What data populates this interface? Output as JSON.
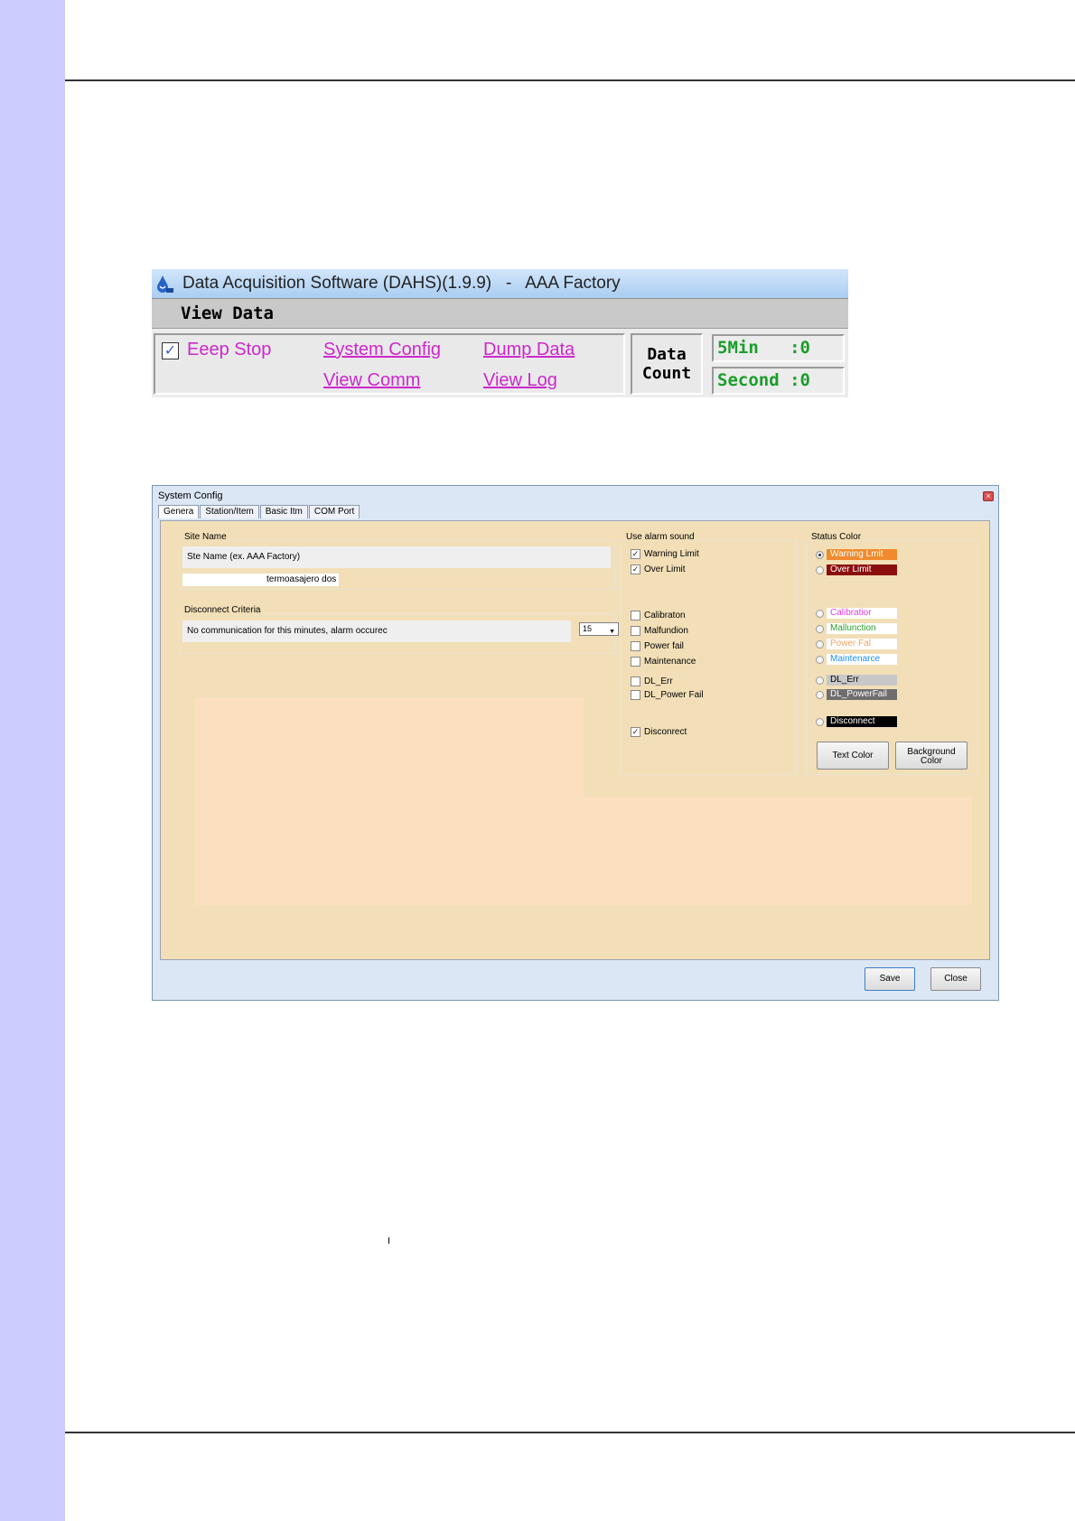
{
  "dahs_window": {
    "title": "Data Acquisition Software (DAHS)(1.9.9)   -   AAA Factory",
    "menu_view_data": "View Data",
    "beep_stop": {
      "label": "Eeep Stop",
      "checked": true
    },
    "links": {
      "system_config": "System Config",
      "dump_data": "Dump Data",
      "view_comm": "View Comm",
      "view_log": "View Log"
    },
    "data_count_label_line1": "Data",
    "data_count_label_line2": "Count",
    "count_5min": "5Min   :0",
    "count_second": "Second :0",
    "colors": {
      "link": "#cc28cc",
      "count": "#1a9e2a",
      "titlebar": "#b9d7f4"
    },
    "icon": "water-drop-logo-icon"
  },
  "system_config": {
    "title": "System Config",
    "tabs": [
      "Genera",
      "Station/Item",
      "Basic Itm",
      "COM Port"
    ],
    "active_tab": "Genera",
    "site_name": {
      "group_title": "Site Name",
      "hint": "Ste Name (ex. AAA Factory)",
      "value": "termoasajero dos"
    },
    "disconnect_criteria": {
      "group_title": "Disconnect Criteria",
      "description": "No communication for this minutes, alarm occurec",
      "minutes_value": "15"
    },
    "alarm_sound": {
      "group_title": "Use alarm sound",
      "items": [
        {
          "label": "Warning Limit",
          "checked": true
        },
        {
          "label": "Over Limit",
          "checked": true
        },
        {
          "label": "Calibraton",
          "checked": false
        },
        {
          "label": "Malfundion",
          "checked": false
        },
        {
          "label": "Power fail",
          "checked": false
        },
        {
          "label": "Maintenance",
          "checked": false
        },
        {
          "label": "DL_Err",
          "checked": false
        },
        {
          "label": "DL_Power Fail",
          "checked": false
        },
        {
          "label": "Disconrect",
          "checked": true
        }
      ]
    },
    "status_color": {
      "group_title": "Status Color",
      "items": [
        {
          "label": "Warning Lmit",
          "bg": "#f08a2c",
          "fg": "#ffffff",
          "selected": true
        },
        {
          "label": "Over Limit",
          "bg": "#8b0f0f",
          "fg": "#ffffff",
          "selected": false
        },
        {
          "label": "Calibratior",
          "bg": "#ffffff",
          "fg": "#e23ce2",
          "selected": false
        },
        {
          "label": "Mallunction",
          "bg": "#ffffff",
          "fg": "#2ca02c",
          "selected": false
        },
        {
          "label": "Power Fal",
          "bg": "#ffffff",
          "fg": "#f4a460",
          "selected": false
        },
        {
          "label": "Maintenarce",
          "bg": "#ffffff",
          "fg": "#1e90ff",
          "selected": false
        },
        {
          "label": "DL_Err",
          "bg": "#c8c8c8",
          "fg": "#000000",
          "selected": false
        },
        {
          "label": "DL_PowerFail",
          "bg": "#6e6e6e",
          "fg": "#ffffff",
          "selected": false
        },
        {
          "label": "Disconnect",
          "bg": "#000000",
          "fg": "#ffffff",
          "selected": false
        }
      ],
      "text_color_button": "Text Color",
      "background_color_button_line1": "Background",
      "background_color_button_line2": "Color"
    },
    "save_button": "Save",
    "close_button": "Close"
  }
}
